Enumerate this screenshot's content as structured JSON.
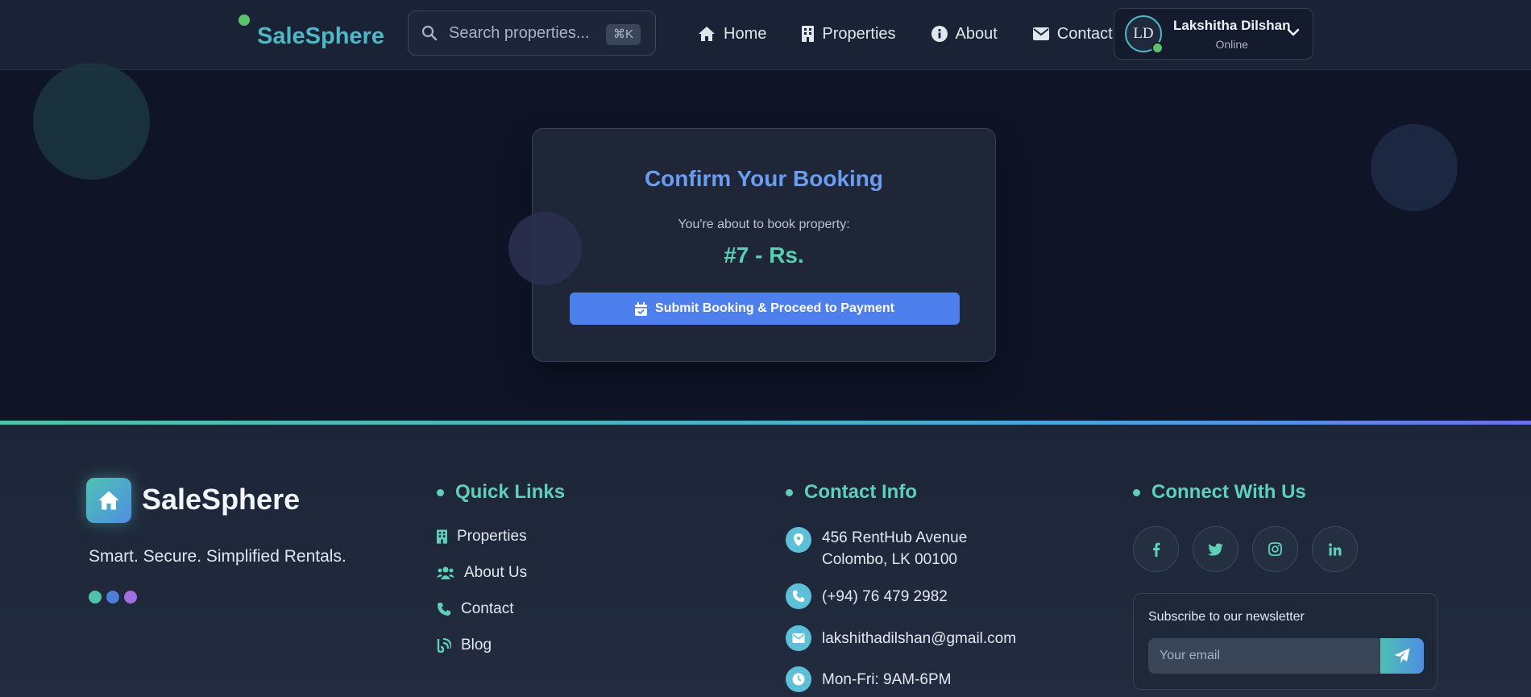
{
  "nav": {
    "brand": "SaleSphere",
    "search_placeholder": "Search properties...",
    "search_shortcut": "⌘K",
    "links": [
      {
        "label": "Home",
        "icon": "home-icon"
      },
      {
        "label": "Properties",
        "icon": "building-icon"
      },
      {
        "label": "About",
        "icon": "info-icon"
      },
      {
        "label": "Contact",
        "icon": "envelope-icon"
      }
    ],
    "user": {
      "initials": "LD",
      "name": "Lakshitha Dilshan",
      "status": "Online"
    }
  },
  "booking": {
    "title": "Confirm Your Booking",
    "subtitle": "You're about to book property:",
    "property": "#7 - Rs.",
    "button_label": "Submit Booking & Proceed to Payment"
  },
  "footer": {
    "brand": "SaleSphere",
    "tagline": "Smart. Secure. Simplified Rentals.",
    "dot_colors": [
      "#4fc3a7",
      "#4e7fd8",
      "#a06fe0"
    ],
    "quick_links": {
      "heading": "Quick Links",
      "items": [
        {
          "label": "Properties",
          "icon": "building-icon"
        },
        {
          "label": "About Us",
          "icon": "users-icon"
        },
        {
          "label": "Contact",
          "icon": "phone-icon"
        },
        {
          "label": "Blog",
          "icon": "blog-icon"
        }
      ]
    },
    "contact": {
      "heading": "Contact Info",
      "address_line1": "456 RentHub Avenue",
      "address_line2": "Colombo, LK 00100",
      "phone": "(+94) 76 479 2982",
      "email": "lakshithadilshan@gmail.com",
      "hours": "Mon-Fri: 9AM-6PM"
    },
    "connect": {
      "heading": "Connect With Us",
      "socials": [
        "facebook-icon",
        "twitter-icon",
        "instagram-icon",
        "linkedin-icon"
      ],
      "newsletter_title": "Subscribe to our newsletter",
      "email_placeholder": "Your email"
    }
  },
  "colors": {
    "accent": "#5fd0b7",
    "primary_button": "#4d80ec",
    "title": "#6a9cf0",
    "background": "#0f1527"
  }
}
